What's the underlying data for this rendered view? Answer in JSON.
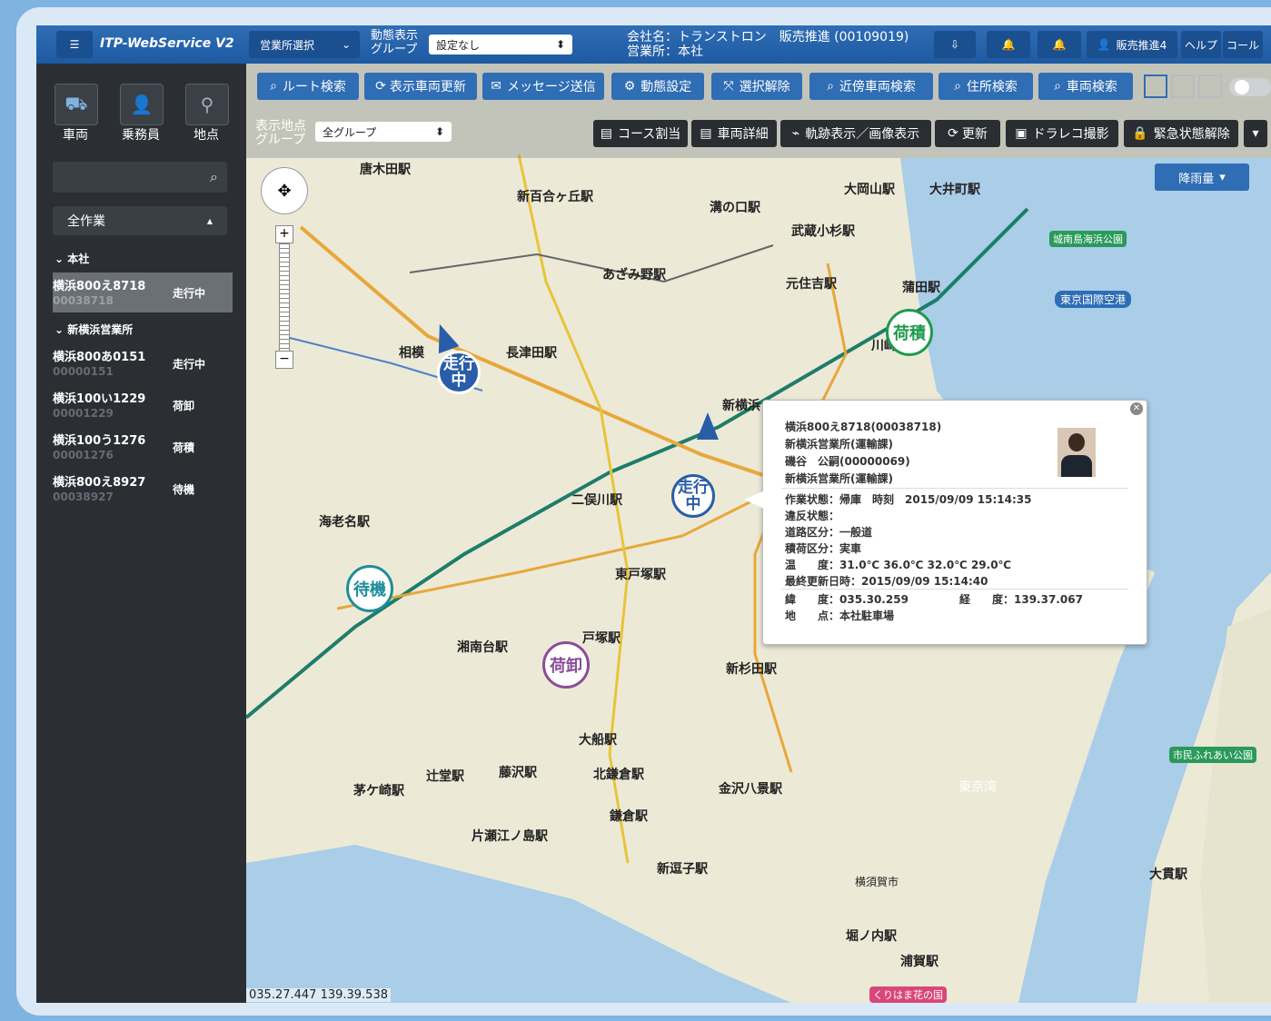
{
  "topbar": {
    "app_title": "ITP-WebService V2",
    "office_select": "営業所選択",
    "dynamic_group_label": "動態表示グループ",
    "dynamic_group_value": "設定なし",
    "company_line1": "会社名：トランストロン　販売推進 (00109019)",
    "company_line2": "営業所：本社",
    "user_name": "販売推進4",
    "help": "ヘルプ",
    "call": "コール"
  },
  "sidebar": {
    "tabs": [
      "車両",
      "乗務員",
      "地点"
    ],
    "filter": "全作業",
    "groups": [
      "本社",
      "新横浜営業所"
    ],
    "vehicles": [
      {
        "id": "横浜800え8718",
        "num": "00038718",
        "status": "走行中"
      },
      {
        "id": "横浜800あ0151",
        "num": "00000151",
        "status": "走行中"
      },
      {
        "id": "横浜100い1229",
        "num": "00001229",
        "status": "荷卸"
      },
      {
        "id": "横浜100う1276",
        "num": "00001276",
        "status": "荷積"
      },
      {
        "id": "横浜800え8927",
        "num": "00038927",
        "status": "待機"
      }
    ]
  },
  "toolbar": {
    "route_search": "ルート検索",
    "refresh_vehicles": "表示車両更新",
    "send_message": "メッセージ送信",
    "dynamic_settings": "動態設定",
    "clear_selection": "選択解除",
    "nearby_search": "近傍車両検索",
    "address_search": "住所検索",
    "vehicle_search": "車両検索",
    "display_point_group": "表示地点グループ",
    "all_groups": "全グループ",
    "course_assign": "コース割当",
    "vehicle_detail": "車両詳細",
    "track_display": "軌跡表示／画像表示",
    "update": "更新",
    "dorareko": "ドラレコ撮影",
    "emergency_release": "緊急状態解除",
    "rainfall": "降雨量"
  },
  "markers": {
    "running": "走行中",
    "loading": "荷積",
    "standby": "待機",
    "unloading": "荷卸"
  },
  "popup": {
    "line1": "横浜800え8718(00038718)",
    "line2": "新横浜営業所(運輸課)",
    "line3": "磯谷　公嗣(00000069)",
    "line4": "新横浜営業所(運輸課)",
    "work_status": "作業状態：帰庫　時刻　2015/09/09 15:14:35",
    "violation": "違反状態：",
    "road_type": "道路区分：一般道",
    "cargo": "積荷区分：実車",
    "temperature": "温　　度：31.0℃ 36.0℃ 32.0℃ 29.0℃",
    "last_update": "最終更新日時：2015/09/09 15:14:40",
    "latitude": "緯　　度：035.30.259",
    "longitude": "経　　度：139.37.067",
    "location": "地　　点：本社駐車場"
  },
  "map": {
    "coords": "035.27.447 139.39.538",
    "stations": [
      "唐木田駅",
      "新百合ヶ丘駅",
      "溝の口駅",
      "大岡山駅",
      "大井町駅",
      "武蔵小杉駅",
      "あざみ野駅",
      "元住吉駅",
      "蒲田駅",
      "長津田駅",
      "相模",
      "新横浜",
      "二俣川駅",
      "海老名駅",
      "東戸塚駅",
      "湘南台駅",
      "戸塚駅",
      "新杉田駅",
      "大船駅",
      "辻堂駅",
      "藤沢駅",
      "北鎌倉駅",
      "茅ケ崎駅",
      "金沢八景駅",
      "鎌倉駅",
      "片瀬江ノ島駅",
      "新逗子駅",
      "堀ノ内駅",
      "浦賀駅",
      "大貫駅",
      "川崎駅",
      "東京湾"
    ],
    "places": [
      "城南島海浜公園",
      "東京国際空港",
      "市民ふれあい公園",
      "横須賀市",
      "くりはま花の国"
    ]
  },
  "colors": {
    "topbar": "#2f6db4",
    "running_marker": "#2a5da8",
    "loading_marker": "#1e9a4b",
    "standby_marker": "#1e8c9a",
    "unloading_marker": "#8a4d9a"
  }
}
